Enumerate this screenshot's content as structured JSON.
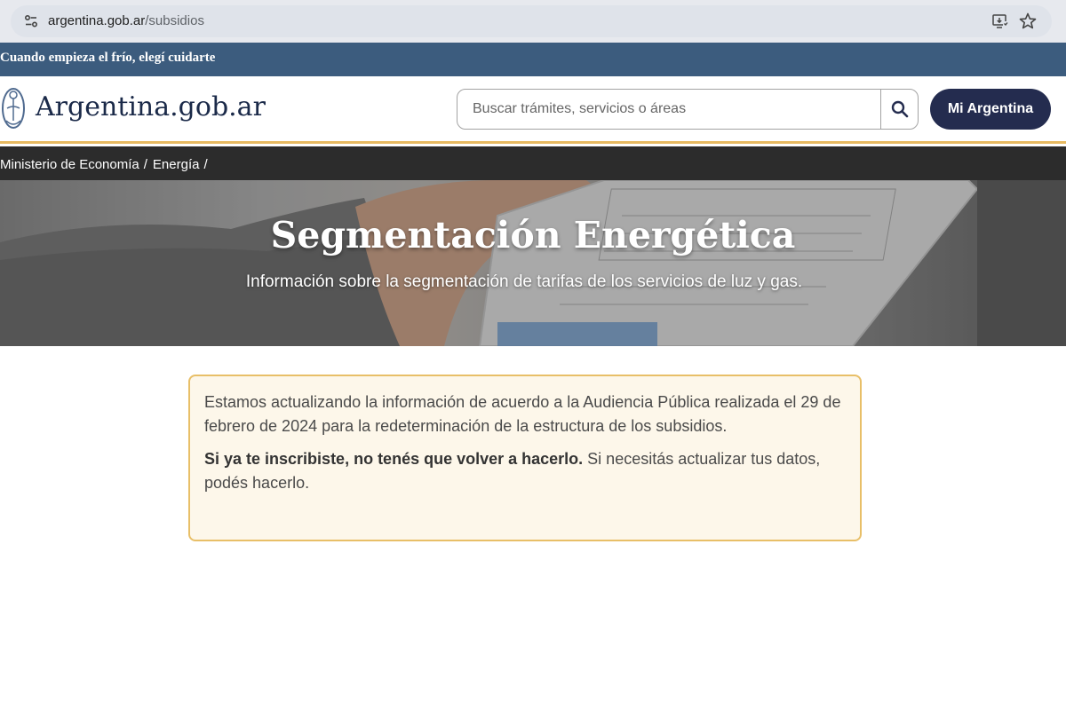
{
  "browser": {
    "url_domain": "argentina.gob.ar",
    "url_path": "/subsidios"
  },
  "top_banner": {
    "text": "Cuando empieza el frío, elegí cuidarte"
  },
  "header": {
    "logo_text": "Argentina.gob.ar",
    "search_placeholder": "Buscar trámites, servicios o áreas",
    "mi_argentina_label": "Mi Argentina"
  },
  "breadcrumb": {
    "items": [
      {
        "label": "Ministerio de Economía"
      },
      {
        "label": "Energía"
      }
    ],
    "separator": "/"
  },
  "hero": {
    "title": "Segmentación Energética",
    "subtitle": "Información sobre la segmentación de tarifas de los servicios de luz y gas."
  },
  "notice": {
    "paragraph_1": "Estamos actualizando la información de acuerdo a la Audiencia Pública realizada el 29 de febrero de 2024 para la redeterminación de la estructura de los subsidios.",
    "paragraph_2_bold": "Si ya te inscribiste, no tenés que volver a hacerlo.",
    "paragraph_2_rest": " Si necesitás actualizar tus datos, podés hacerlo."
  },
  "colors": {
    "banner_blue": "#3c5c7e",
    "header_border_gold": "#e7ba61",
    "breadcrumb_bg": "#2c2c2c",
    "button_navy": "#242c4f",
    "notice_bg": "#fdf7ea",
    "notice_border": "#e8bf68"
  },
  "icons": {
    "site_info": "site-info-icon",
    "install": "install-app-icon",
    "bookmark": "star-icon",
    "search": "search-icon",
    "logo": "argentina-emblem-icon"
  }
}
